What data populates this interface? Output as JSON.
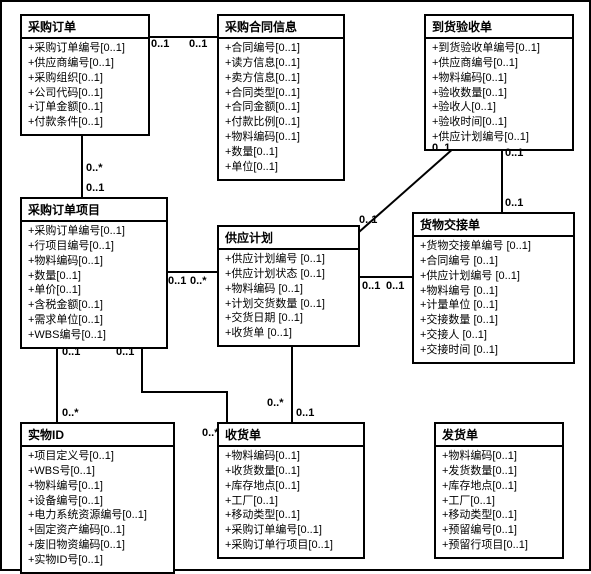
{
  "classes": {
    "po": {
      "title": "采购订单",
      "attrs": [
        "+采购订单编号[0..1]",
        "+供应商编号[0..1]",
        "+采购组织[0..1]",
        "+公司代码[0..1]",
        "+订单金额[0..1]",
        "+付款条件[0..1]"
      ]
    },
    "contract": {
      "title": "采购合同信息",
      "attrs": [
        "+合同编号[0..1]",
        "+读方信息[0..1]",
        "+卖方信息[0..1]",
        "+合同类型[0..1]",
        "+合同金额[0..1]",
        "+付款比例[0..1]",
        "+物料编码[0..1]",
        "+数量[0..1]",
        "+单位[0..1]"
      ]
    },
    "arrival": {
      "title": "到货验收单",
      "attrs": [
        "+到货验收单编号[0..1]",
        "+供应商编号[0..1]",
        "+物料编码[0..1]",
        "+验收数量[0..1]",
        "+验收人[0..1]",
        "+验收时间[0..1]",
        "+供应计划编号[0..1]"
      ]
    },
    "poitem": {
      "title": "采购订单项目",
      "attrs": [
        "+采购订单编号[0..1]",
        "+行项目编号[0..1]",
        "+物料编码[0..1]",
        "+数量[0..1]",
        "+单价[0..1]",
        "+含税金额[0..1]",
        "+需求单位[0..1]",
        "+WBS编号[0..1]"
      ]
    },
    "plan": {
      "title": "供应计划",
      "attrs": [
        "+供应计划编号 [0..1]",
        "+供应计划状态 [0..1]",
        "+物料编码 [0..1]",
        "+计划交货数量 [0..1]",
        "+交货日期 [0..1]",
        "+收货单 [0..1]"
      ]
    },
    "deliver": {
      "title": "货物交接单",
      "attrs": [
        "+货物交接单编号 [0..1]",
        "+合同编号 [0..1]",
        "+供应计划编号 [0..1]",
        "+物料编号 [0..1]",
        "+计量单位 [0..1]",
        "+交接数量 [0..1]",
        "+交接人 [0..1]",
        "+交接时间 [0..1]"
      ]
    },
    "objid": {
      "title": "实物ID",
      "attrs": [
        "+项目定义号[0..1]",
        "+WBS号[0..1]",
        "+物料编号[0..1]",
        "+设备编号[0..1]",
        "+电力系统资源编号[0..1]",
        "+固定资产编码[0..1]",
        "+废旧物资编码[0..1]",
        "+实物ID号[0..1]"
      ]
    },
    "receipt": {
      "title": "收货单",
      "attrs": [
        "+物料编码[0..1]",
        "+收货数量[0..1]",
        "+库存地点[0..1]",
        "+工厂[0..1]",
        "+移动类型[0..1]",
        "+采购订单编号[0..1]",
        "+采购订单行项目[0..1]"
      ]
    },
    "issue": {
      "title": "发货单",
      "attrs": [
        "+物料编码[0..1]",
        "+发货数量[0..1]",
        "+库存地点[0..1]",
        "+工厂[0..1]",
        "+移动类型[0..1]",
        "+预留编号[0..1]",
        "+预留行项目[0..1]"
      ]
    }
  },
  "mults": {
    "po_contract_l": "0..1",
    "po_contract_r": "0..1",
    "po_item_t": "0..*",
    "po_item_b": "0..1",
    "item_plan_l": "0..1",
    "item_plan_r": "0..*",
    "plan_arrival_b": "0..1",
    "plan_arrival_t": "0..1",
    "plan_deliver_l": "0..1",
    "plan_deliver_r": "0..1",
    "arrival_deliver_t": "0..1",
    "arrival_deliver_b": "0..1",
    "plan_receipt_t": "0..*",
    "plan_receipt_b": "0..1",
    "item_receipt_t": "0..1",
    "item_receipt_b": "0..*",
    "item_objid_t": "0..1",
    "item_objid_b": "0..*"
  }
}
